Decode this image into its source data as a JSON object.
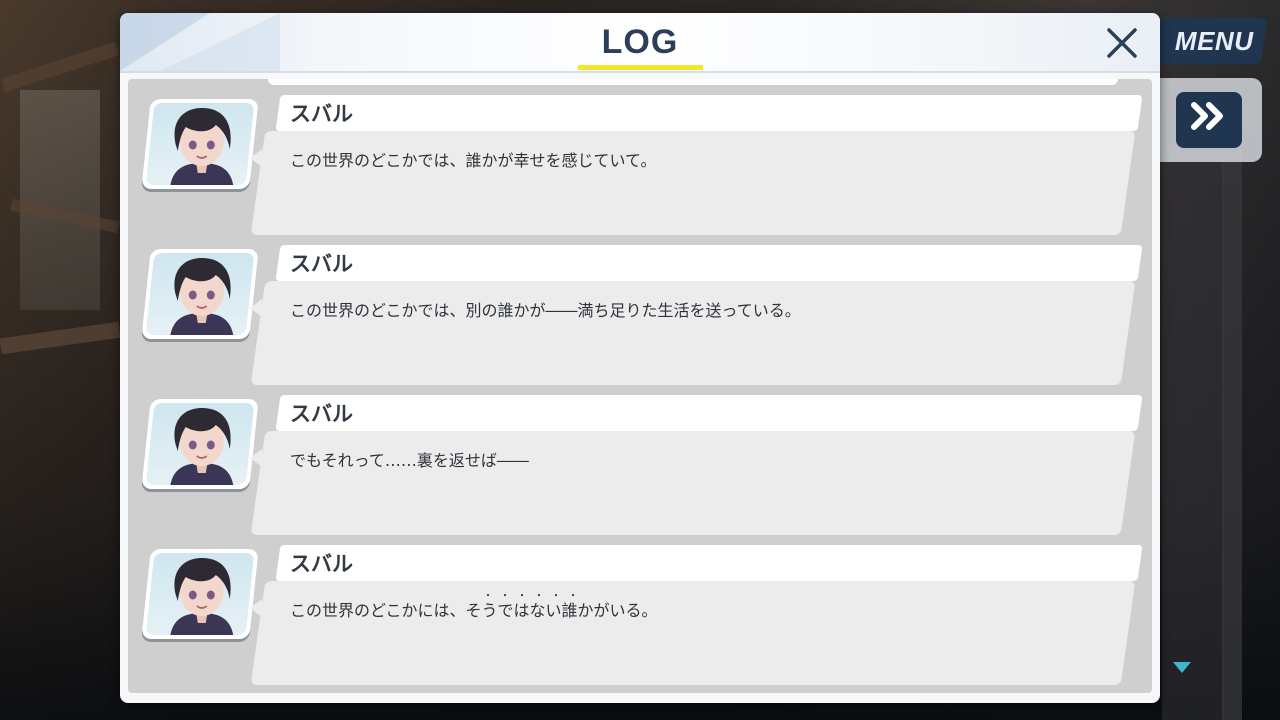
{
  "header": {
    "title": "LOG"
  },
  "controls": {
    "menu_label": "MENU",
    "fast_forward_label": "»"
  },
  "entries": [
    {
      "speaker": "スバル",
      "text": "この世界のどこかでは、誰かが幸せを感じていて。"
    },
    {
      "speaker": "スバル",
      "text": "この世界のどこかでは、別の誰かが――満ち足りた生活を送っている。"
    },
    {
      "speaker": "スバル",
      "text": "でもそれって……裏を返せば――"
    },
    {
      "speaker": "スバル",
      "text": "この世界のどこかには、そうではない誰かがいる。",
      "emphasis_dots": "・・・・・・"
    }
  ],
  "icons": {
    "close": "close-icon",
    "fast_forward": "fast-forward-icon",
    "scroll_down": "scroll-down-arrow-icon",
    "avatar": "character-portrait"
  },
  "colors": {
    "title_text": "#2b3e5a",
    "title_underline": "#f5e62b",
    "button_bg": "#1f3550",
    "scroll_arrow": "#3fb6c9"
  }
}
